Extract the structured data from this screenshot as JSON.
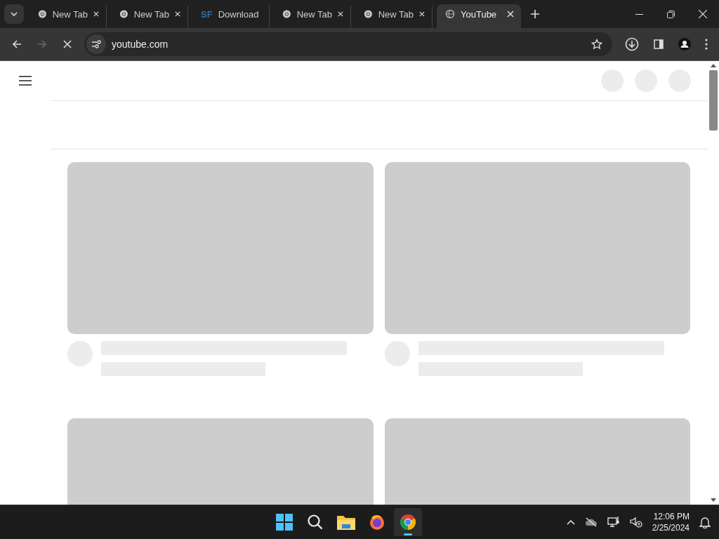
{
  "tabs": [
    {
      "title": "New Tab",
      "kind": "chrome",
      "selected": false
    },
    {
      "title": "New Tab",
      "kind": "chrome",
      "selected": false
    },
    {
      "title": "Download",
      "kind": "sf",
      "favicon_text": "SF",
      "selected": false
    },
    {
      "title": "New Tab",
      "kind": "chrome",
      "selected": false
    },
    {
      "title": "New Tab",
      "kind": "chrome",
      "selected": false
    },
    {
      "title": "YouTube",
      "kind": "globe",
      "selected": true
    }
  ],
  "toolbar": {
    "back_disabled": false,
    "forward_disabled": true,
    "loading": true,
    "url": "youtube.com"
  },
  "taskbar": {
    "apps": [
      {
        "kind": "start",
        "selected": false
      },
      {
        "kind": "search",
        "selected": false
      },
      {
        "kind": "files",
        "selected": false
      },
      {
        "kind": "firefox",
        "selected": false
      },
      {
        "kind": "chrome",
        "selected": true
      }
    ],
    "time": "12:06 PM",
    "date": "2/25/2024"
  }
}
